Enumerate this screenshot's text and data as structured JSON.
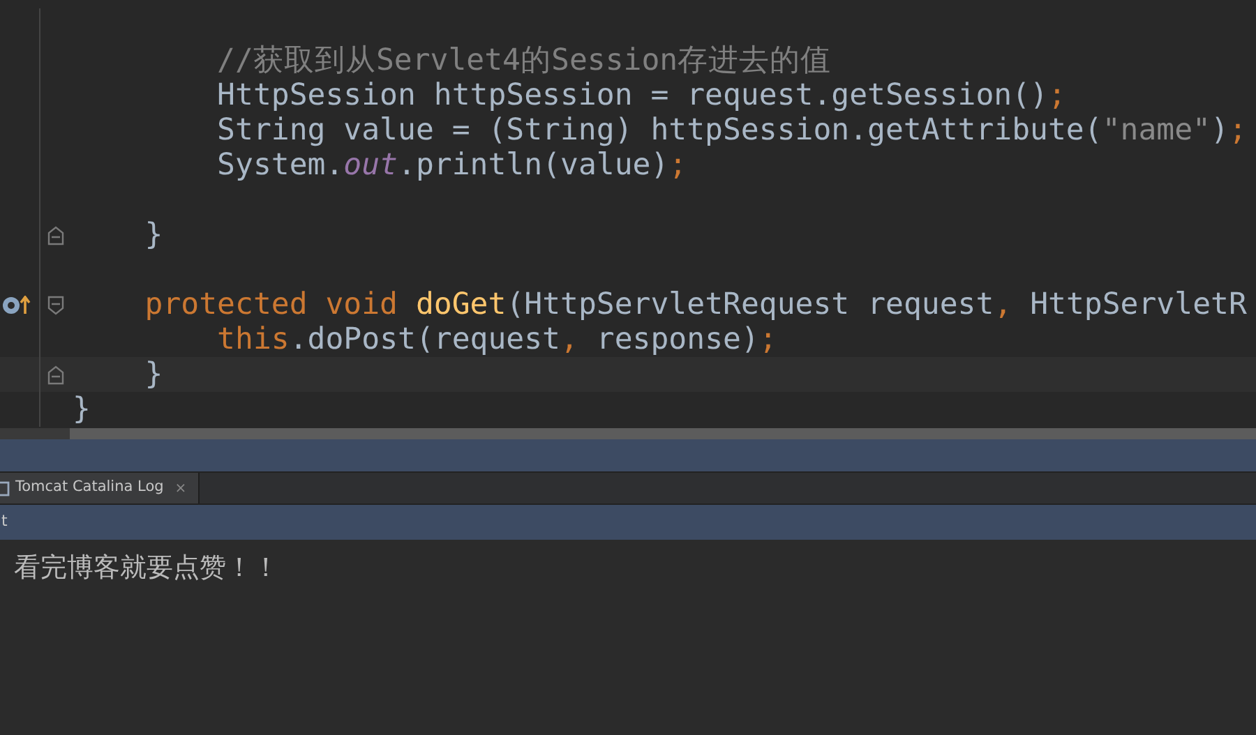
{
  "editor": {
    "lines": [
      {
        "kind": "blank"
      },
      {
        "kind": "code",
        "tokens": [
          {
            "kind": "comment",
            "text": "        //获取到从Servlet4的Session存进去的值"
          }
        ]
      },
      {
        "kind": "code",
        "tokens": [
          {
            "kind": "plain",
            "text": "        HttpSession httpSession = request.getSession()"
          },
          {
            "kind": "keyword",
            "text": ";"
          }
        ]
      },
      {
        "kind": "code",
        "tokens": [
          {
            "kind": "plain",
            "text": "        String value = (String) httpSession.getAttribute("
          },
          {
            "kind": "string",
            "text": "\"name\""
          },
          {
            "kind": "plain",
            "text": ")"
          },
          {
            "kind": "keyword",
            "text": ";"
          }
        ]
      },
      {
        "kind": "code",
        "tokens": [
          {
            "kind": "plain",
            "text": "        System."
          },
          {
            "kind": "field",
            "text": "out"
          },
          {
            "kind": "plain",
            "text": ".println(value)"
          },
          {
            "kind": "keyword",
            "text": ";"
          }
        ]
      },
      {
        "kind": "blank"
      },
      {
        "kind": "code",
        "fold_end": true,
        "tokens": [
          {
            "kind": "plain",
            "text": "    }"
          }
        ]
      },
      {
        "kind": "blank"
      },
      {
        "kind": "code",
        "fold_start": true,
        "override": true,
        "tokens": [
          {
            "kind": "keyword",
            "text": "    protected void "
          },
          {
            "kind": "method",
            "text": "doGet"
          },
          {
            "kind": "plain",
            "text": "(HttpServletRequest request"
          },
          {
            "kind": "keyword",
            "text": ", "
          },
          {
            "kind": "plain",
            "text": "HttpServletR"
          }
        ]
      },
      {
        "kind": "code",
        "tokens": [
          {
            "kind": "keyword",
            "text": "        this"
          },
          {
            "kind": "plain",
            "text": ".doPost(request"
          },
          {
            "kind": "keyword",
            "text": ", "
          },
          {
            "kind": "plain",
            "text": "response)"
          },
          {
            "kind": "keyword",
            "text": ";"
          }
        ]
      },
      {
        "kind": "code",
        "fold_end": true,
        "current": true,
        "tokens": [
          {
            "kind": "plain",
            "text": "    }"
          }
        ]
      },
      {
        "kind": "code",
        "tokens": [
          {
            "kind": "plain",
            "text": "}"
          }
        ]
      }
    ]
  },
  "tool_window": {
    "tabs": [
      {
        "label": "Tomcat Catalina Log",
        "close": "×",
        "selected": true
      }
    ],
    "toolbar_text": "t",
    "console_output": "看完博客就要点赞！！"
  }
}
